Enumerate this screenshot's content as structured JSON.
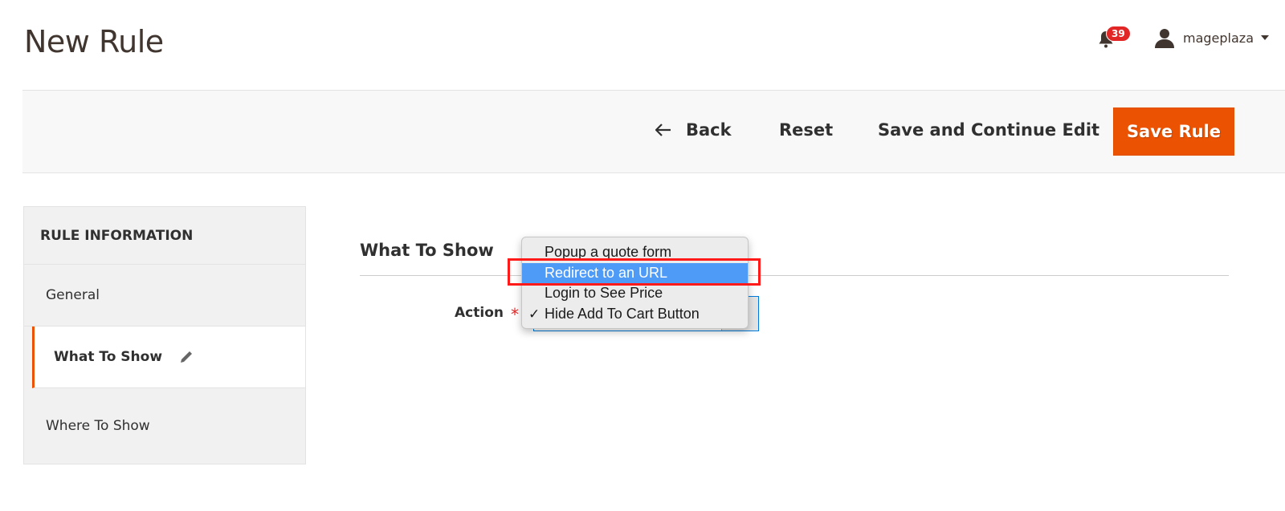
{
  "header": {
    "title": "New Rule",
    "notifications_count": "39",
    "username": "mageplaza"
  },
  "toolbar": {
    "back_label": "Back",
    "reset_label": "Reset",
    "save_continue_label": "Save and Continue Edit",
    "save_label": "Save Rule",
    "accent_color": "#eb5202"
  },
  "sidebar": {
    "title": "RULE INFORMATION",
    "items": [
      {
        "label": "General",
        "active": false
      },
      {
        "label": "What To Show",
        "active": true
      },
      {
        "label": "Where To Show",
        "active": false
      }
    ]
  },
  "main": {
    "section_title": "What To Show",
    "action_label": "Action",
    "required_mark": "*",
    "action_dropdown": {
      "options": [
        {
          "label": "Popup a quote form",
          "checked": false,
          "highlighted": false
        },
        {
          "label": "Redirect to an URL",
          "checked": false,
          "highlighted": true
        },
        {
          "label": "Login to See Price",
          "checked": false,
          "highlighted": false
        },
        {
          "label": "Hide Add To Cart Button",
          "checked": true,
          "highlighted": false
        }
      ],
      "selected": "Hide Add To Cart Button",
      "check_glyph": "✓",
      "highlight_color": "#4d9bf7",
      "annotation_color": "#ff1a1a"
    }
  }
}
